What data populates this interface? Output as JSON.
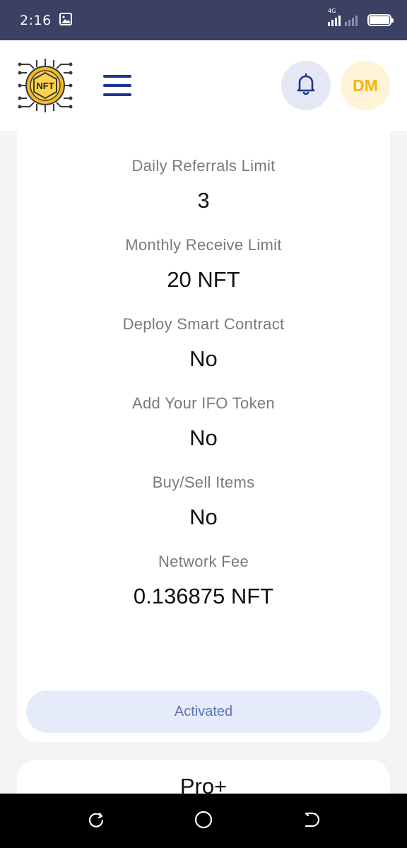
{
  "status_bar": {
    "time": "2:16",
    "network": "4G"
  },
  "header": {
    "logo_text": "NFT",
    "avatar_initials": "DM"
  },
  "plan_details": {
    "features": [
      {
        "label": "Daily Referrals Limit",
        "value": "3"
      },
      {
        "label": "Monthly Receive Limit",
        "value": "20 NFT"
      },
      {
        "label": "Deploy Smart Contract",
        "value": "No"
      },
      {
        "label": "Add Your IFO Token",
        "value": "No"
      },
      {
        "label": "Buy/Sell Items",
        "value": "No"
      },
      {
        "label": "Network Fee",
        "value": "0.136875 NFT"
      }
    ],
    "button_label": "Activated"
  },
  "next_plan": {
    "title": "Pro+"
  },
  "colors": {
    "status_bar": "#3a4163",
    "accent_blue": "#1d3493",
    "avatar_bg": "#fef3d6",
    "avatar_text": "#f2b705",
    "button_bg": "#e5ebfb",
    "button_text": "#5f73b4"
  }
}
